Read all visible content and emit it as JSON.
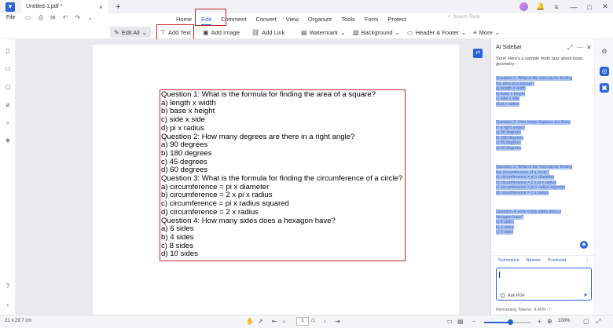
{
  "titlebar": {
    "tab_label": "Untitled-1.pdf *",
    "tab_close": "×",
    "add_tab": "+",
    "icons": [
      "profile-avatar",
      "bell-icon",
      "menu-icon"
    ],
    "window_controls": [
      "—",
      "□",
      "✕"
    ]
  },
  "menubar": {
    "file_label": "File",
    "items": [
      "Home",
      "Edit",
      "Comment",
      "Convert",
      "View",
      "Organize",
      "Tools",
      "Form",
      "Protect"
    ],
    "active": "Edit",
    "search_placeholder": "Search Tools"
  },
  "toolbar": {
    "edit_all": "Edit All",
    "add_text": "Add Text",
    "add_image": "Add Image",
    "add_link": "Add Link",
    "watermark": "Watermark",
    "background": "Background",
    "header_footer": "Header & Footer",
    "more": "More"
  },
  "quiz": {
    "lines": [
      "Question 1: What is the formula for finding the area of a square?",
      "a) length x width",
      "b) base x height",
      "c) side x side",
      "d) pi x radius",
      "Question 2: How many degrees are there in a right angle?",
      "a) 90 degrees",
      "b) 180 degrees",
      "c) 45 degrees",
      "d) 60 degrees",
      "Question 3: What is the formula for finding the circumference of a circle?",
      "a) circumference = pi x diameter",
      "b) circumference = 2 x pi x radius",
      "c) circumference = pi x radius squared",
      "d) circumference = 2 x radius",
      "Question 4: How many sides does a hexagon have?",
      "a) 6 sides",
      "b) 4 sides",
      "c) 8 sides",
      "d) 10 sides"
    ]
  },
  "ai_sidebar": {
    "title": "AI Sidebar",
    "intro": "Sure! Here's a sample math quiz about basic geometry:",
    "q1": [
      "Question 1: What is the formula for finding the area of a square?",
      "a) length x width",
      "b) base x height",
      "c) side x side",
      "d) pi x radius"
    ],
    "q2": [
      "Question 2: How many degrees are there in a right angle?",
      "a) 90 degrees",
      "b) 180 degrees",
      "c) 45 degrees",
      "d) 60 degrees"
    ],
    "q3": [
      "Question 3: What is the formula for finding the circumference of a circle?",
      "a) circumference = pi x diameter",
      "b) circumference = 2 x pi x radius",
      "c) circumference = pi x radius squared",
      "d) circumference = 2 x radius"
    ],
    "q4": [
      "Question 4: How many sides does a hexagon have?",
      "a) 6 sides",
      "b) 4 sides",
      "c) 8 sides"
    ],
    "tabs": [
      "Summarize",
      "Rewrite",
      "Proofread"
    ],
    "ask_pdf": "Ask PDF",
    "tokens": "Remaining Tokens: 4.46%"
  },
  "status": {
    "dimensions": "21 x 29.7 cm",
    "page_current": "1",
    "page_count": "/1",
    "zoom": "100%",
    "zoom_level": 0.55
  },
  "colors": {
    "accent": "#2962d9",
    "highlight_box": "#c0262d",
    "ai_selection": "#a9c4f3"
  }
}
